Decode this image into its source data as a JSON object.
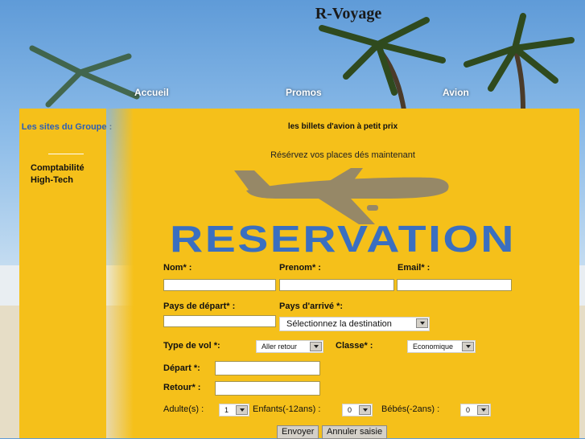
{
  "site": {
    "title": "R-Voyage"
  },
  "nav": {
    "items": [
      {
        "label": "Accueil"
      },
      {
        "label": "Promos"
      },
      {
        "label": "Avion"
      }
    ]
  },
  "sidebar": {
    "title": "Les sites du Groupe :",
    "links": [
      {
        "label": "Comptabilité"
      },
      {
        "label": "High-Tech"
      }
    ]
  },
  "main": {
    "headline": "les billets d'avion à petit prix",
    "subline": "Résérvez vos places dés maintenant",
    "banner_text": "RESERVATION"
  },
  "form": {
    "nom_label": "Nom* :",
    "prenom_label": "Prenom* :",
    "email_label": "Email* :",
    "pays_depart_label": "Pays de départ* :",
    "pays_arrive_label": "Pays d'arrivé *:",
    "pays_arrive_value": "Sélectionnez la destination",
    "type_vol_label": "Type de vol *:",
    "type_vol_value": "Aller retour",
    "classe_label": "Classe* :",
    "classe_value": "Economique",
    "depart_label": "Départ *:",
    "retour_label": "Retour* :",
    "adultes_label": "Adulte(s) :",
    "adultes_value": "1",
    "enfants_label": "Enfants(-12ans) :",
    "enfants_value": "0",
    "bebes_label": "Bébés(-2ans) :",
    "bebes_value": "0",
    "submit_label": "Envoyer",
    "reset_label": "Annuler saisie"
  },
  "colors": {
    "panel": "#f5c01a",
    "banner_text": "#3a6fc0",
    "sidebar_title": "#2b5fb8"
  }
}
